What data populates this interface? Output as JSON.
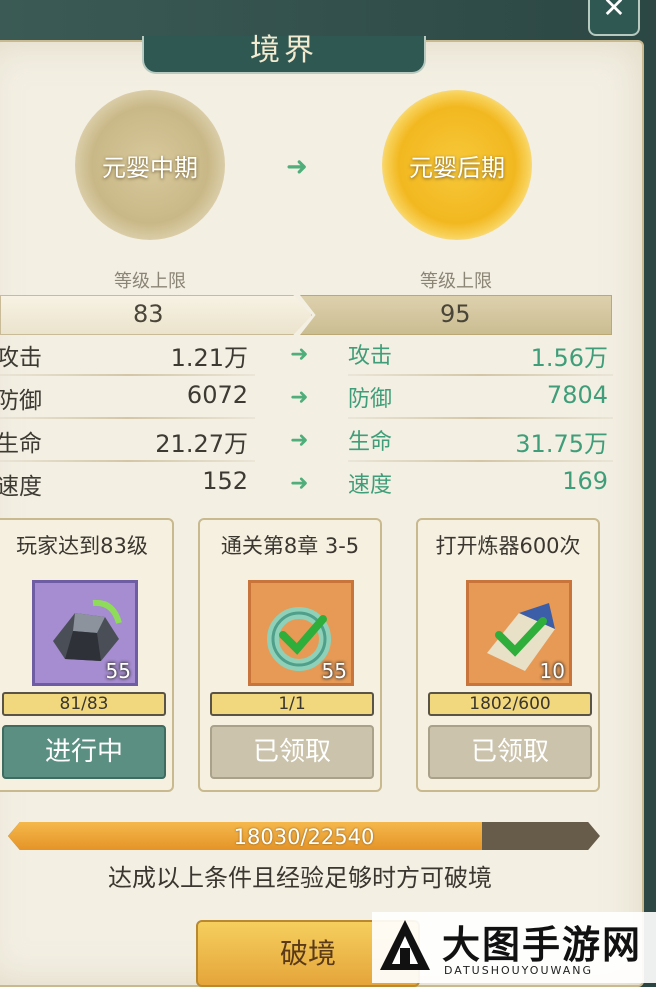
{
  "window": {
    "title": "境界",
    "close_glyph": "✕"
  },
  "realms": {
    "current": "元婴中期",
    "next": "元婴后期"
  },
  "level_cap": {
    "label_left": "等级上限",
    "label_right": "等级上限",
    "current": "83",
    "next": "95"
  },
  "stats": [
    {
      "name_left": "攻击",
      "value_left": "1.21万",
      "name_right": "攻击",
      "value_right": "1.56万"
    },
    {
      "name_left": "防御",
      "value_left": "6072",
      "name_right": "防御",
      "value_right": "7804"
    },
    {
      "name_left": "生命",
      "value_left": "21.27万",
      "name_right": "生命",
      "value_right": "31.75万"
    },
    {
      "name_left": "速度",
      "value_left": "152",
      "name_right": "速度",
      "value_right": "169"
    }
  ],
  "conditions": [
    {
      "title": "玩家达到83级",
      "item_count": "55",
      "progress": "81/83",
      "button": "进行中",
      "item_icon": "stone-icon"
    },
    {
      "title": "通关第8章 3-5",
      "item_count": "55",
      "progress": "1/1",
      "button": "已领取",
      "item_icon": "jade-ring-icon"
    },
    {
      "title": "打开炼器600次",
      "item_count": "10",
      "progress": "1802/600",
      "button": "已领取",
      "item_icon": "scroll-icon"
    }
  ],
  "experience": {
    "text": "18030/22540",
    "current": 18030,
    "total": 22540
  },
  "hint": "达成以上条件且经验足够时方可破境",
  "break_button": "破境",
  "watermark": {
    "title": "大图手游网",
    "subtitle": "DATUSHOUYOUWANG"
  },
  "colors": {
    "accent_green": "#3f9e79",
    "button_gold": "#e5a53a",
    "active_teal": "#5b8f82"
  }
}
